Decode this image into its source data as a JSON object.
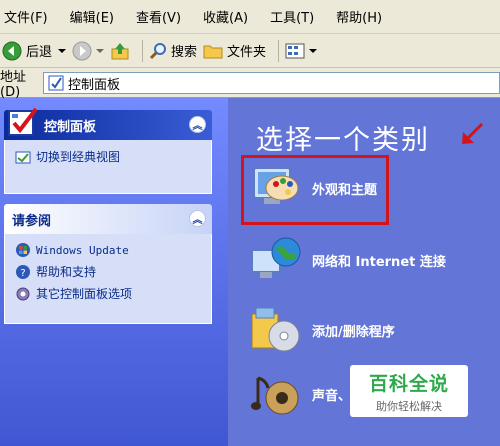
{
  "menubar": {
    "items": [
      "文件(F)",
      "编辑(E)",
      "查看(V)",
      "收藏(A)",
      "工具(T)",
      "帮助(H)"
    ]
  },
  "toolbar": {
    "back_label": "后退",
    "search_label": "搜索",
    "folders_label": "文件夹"
  },
  "address": {
    "label": "地址(D)",
    "value": "控制面板"
  },
  "left_pane": {
    "panel1": {
      "title": "控制面板",
      "items": [
        "切换到经典视图"
      ]
    },
    "panel2": {
      "title": "请参阅",
      "items": [
        "Windows Update",
        "帮助和支持",
        "其它控制面板选项"
      ]
    }
  },
  "main": {
    "heading": "选择一个类别",
    "categories": [
      {
        "label": "外观和主题",
        "icon": "appearance-themes-icon"
      },
      {
        "label": "网络和 Internet 连接",
        "icon": "network-globe-icon"
      },
      {
        "label": "添加/删除程序",
        "icon": "add-remove-programs-icon"
      },
      {
        "label": "声音、",
        "icon": "sounds-icon"
      }
    ]
  },
  "watermark": {
    "title": "百科全说",
    "subtitle": "助你轻松解决"
  },
  "colors": {
    "pane_blue": "#6375d6",
    "highlight_red": "#d4141b",
    "watermark_green": "#2eaa4c"
  }
}
